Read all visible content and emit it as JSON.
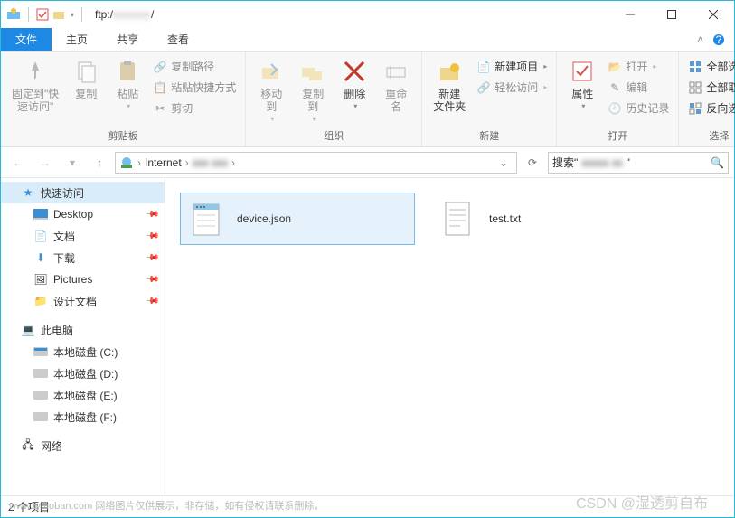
{
  "title": {
    "prefix": "ftp:/",
    "blurred": "xxxxxx",
    "suffix": "/"
  },
  "tabs": {
    "file": "文件",
    "home": "主页",
    "share": "共享",
    "view": "查看"
  },
  "ribbon": {
    "clipboard": {
      "label": "剪贴板",
      "pin": "固定到\"快\n速访问\"",
      "copy": "复制",
      "paste": "粘贴",
      "copy_path": "复制路径",
      "paste_shortcut": "粘贴快捷方式",
      "cut": "剪切"
    },
    "organize": {
      "label": "组织",
      "move_to": "移动到",
      "copy_to": "复制到",
      "delete": "删除",
      "rename": "重命名"
    },
    "new": {
      "label": "新建",
      "new_folder": "新建\n文件夹",
      "new_item": "新建项目",
      "easy_access": "轻松访问"
    },
    "open": {
      "label": "打开",
      "properties": "属性",
      "open": "打开",
      "edit": "编辑",
      "history": "历史记录"
    },
    "select": {
      "label": "选择",
      "all": "全部选择",
      "none": "全部取消",
      "invert": "反向选择"
    }
  },
  "nav": {
    "crumb1": "Internet",
    "crumb2_blur": "xxx  xxx",
    "search_prefix": "搜索\"",
    "search_blur": "xxxxx  xx",
    "search_suffix": "\""
  },
  "sidebar": {
    "quick": "快速访问",
    "desktop": "Desktop",
    "docs": "文档",
    "downloads": "下载",
    "pictures": "Pictures",
    "design": "设计文档",
    "thispc": "此电脑",
    "c": "本地磁盘 (C:)",
    "d": "本地磁盘 (D:)",
    "e": "本地磁盘 (E:)",
    "f": "本地磁盘 (F:)",
    "network": "网络"
  },
  "files": {
    "f1": "device.json",
    "f2": "test.txt"
  },
  "status": "2 个项目",
  "watermark_left": "www.tymoban.com   网络图片仅供展示，非存储，如有侵权请联系删除。",
  "watermark_right": "CSDN @湿透剪自布"
}
